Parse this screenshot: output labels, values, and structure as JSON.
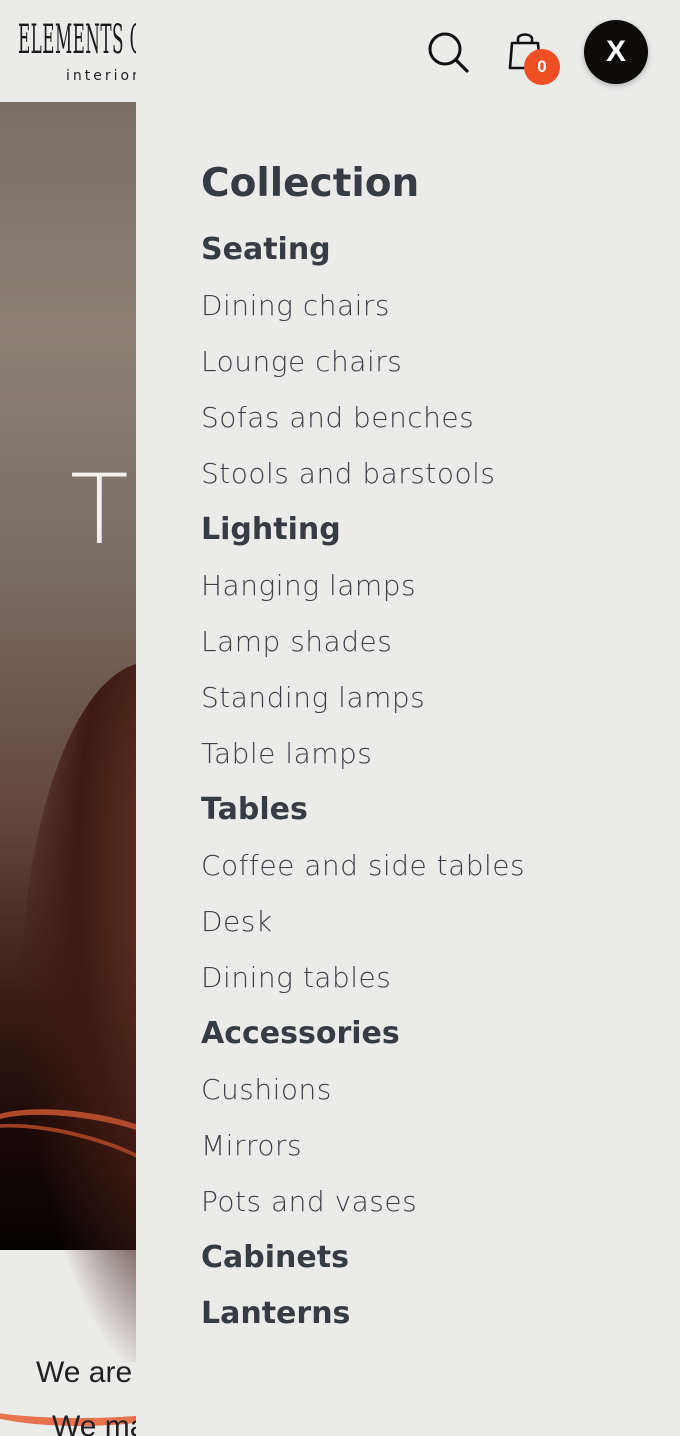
{
  "brand": {
    "logo_text": "ELEMENTS COLLECTION",
    "logo_sub": "interior"
  },
  "hero": {
    "title": "TI"
  },
  "intro": {
    "line1": "We are",
    "line2": "We ma"
  },
  "header": {
    "search_icon": "search-icon",
    "cart_icon": "shopping-bag-icon",
    "cart_count": "0",
    "close_label": "X"
  },
  "colors": {
    "badge": "#f04e23",
    "close_bg": "#0d0b0a",
    "drawer_bg": "#ebebea",
    "text": "#373b43"
  },
  "menu": {
    "title": "Collection",
    "groups": [
      {
        "title": "Seating",
        "items": [
          "Dining chairs",
          "Lounge chairs",
          "Sofas and benches",
          "Stools and barstools"
        ]
      },
      {
        "title": "Lighting",
        "items": [
          "Hanging lamps",
          "Lamp shades",
          "Standing lamps",
          "Table lamps"
        ]
      },
      {
        "title": "Tables",
        "items": [
          "Coffee and side tables",
          "Desk",
          "Dining tables"
        ]
      },
      {
        "title": "Accessories",
        "items": [
          "Cushions",
          "Mirrors",
          "Pots and vases"
        ]
      },
      {
        "title": "Cabinets",
        "items": []
      },
      {
        "title": "Lanterns",
        "items": []
      }
    ]
  }
}
